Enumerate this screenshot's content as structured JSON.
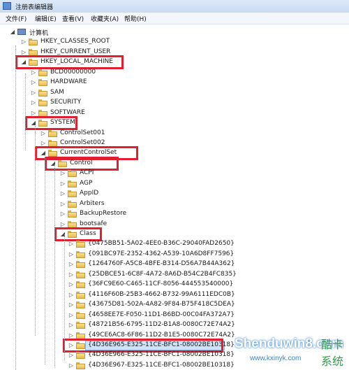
{
  "window": {
    "title": "注册表编辑器"
  },
  "menu": [
    "文件(F)",
    "编辑(E)",
    "查看(V)",
    "收藏夹(A)",
    "帮助(H)"
  ],
  "tree": [
    {
      "label": "计算机",
      "depth": 0,
      "expanded": true,
      "type": "computer"
    },
    {
      "label": "HKEY_CLASSES_ROOT",
      "depth": 1,
      "expanded": false
    },
    {
      "label": "HKEY_CURRENT_USER",
      "depth": 1,
      "expanded": false
    },
    {
      "label": "HKEY_LOCAL_MACHINE",
      "depth": 1,
      "expanded": true,
      "highlight": true
    },
    {
      "label": "BCD00000000",
      "depth": 2,
      "expanded": false
    },
    {
      "label": "HARDWARE",
      "depth": 2,
      "expanded": false
    },
    {
      "label": "SAM",
      "depth": 2,
      "expanded": false
    },
    {
      "label": "SECURITY",
      "depth": 2,
      "expanded": false
    },
    {
      "label": "SOFTWARE",
      "depth": 2,
      "expanded": false
    },
    {
      "label": "SYSTEM",
      "depth": 2,
      "expanded": true,
      "highlight": true
    },
    {
      "label": "ControlSet001",
      "depth": 3,
      "expanded": false
    },
    {
      "label": "ControlSet002",
      "depth": 3,
      "expanded": false
    },
    {
      "label": "CurrentControlSet",
      "depth": 3,
      "expanded": true,
      "highlight": true
    },
    {
      "label": "Control",
      "depth": 4,
      "expanded": true,
      "highlight": true
    },
    {
      "label": "ACPI",
      "depth": 5,
      "expanded": false
    },
    {
      "label": "AGP",
      "depth": 5,
      "expanded": false
    },
    {
      "label": "AppID",
      "depth": 5,
      "expanded": false
    },
    {
      "label": "Arbiters",
      "depth": 5,
      "expanded": false
    },
    {
      "label": "BackupRestore",
      "depth": 5,
      "expanded": false
    },
    {
      "label": "bootsafe",
      "depth": 5,
      "expanded": false
    },
    {
      "label": "Class",
      "depth": 5,
      "expanded": true,
      "highlight": true
    },
    {
      "label": "{0475BB51-5A02-4EE0-B36C-29040FAD2650}",
      "depth": 6,
      "expanded": false
    },
    {
      "label": "{091BC97E-2352-4362-A539-10A6D8FF7596}",
      "depth": 6,
      "expanded": false
    },
    {
      "label": "{1264760F-A5C8-4BFE-B314-D56A7B44A362}",
      "depth": 6,
      "expanded": false
    },
    {
      "label": "{25DBCE51-6C8F-4A72-8A6D-B54C2B4FC835}",
      "depth": 6,
      "expanded": false
    },
    {
      "label": "{36FC9E60-C465-11CF-8056-444553540000}",
      "depth": 6,
      "expanded": false
    },
    {
      "label": "{4116F60B-25B3-4662-B732-99A6111EDC0B}",
      "depth": 6,
      "expanded": false
    },
    {
      "label": "{43675D81-502A-4A82-9F84-B75F418C5DEA}",
      "depth": 6,
      "expanded": false
    },
    {
      "label": "{4658EE7E-F050-11D1-B6BD-00C04FA372A7}",
      "depth": 6,
      "expanded": false
    },
    {
      "label": "{48721B56-6795-11D2-B1A8-0080C72E74A2}",
      "depth": 6,
      "expanded": false
    },
    {
      "label": "{49CE6AC8-6F86-11D2-B1E5-0080C72E74A2}",
      "depth": 6,
      "expanded": false
    },
    {
      "label": "{4D36E965-E325-11CE-BFC1-08002BE10318}",
      "depth": 6,
      "expanded": false,
      "highlight": true,
      "selected": true
    },
    {
      "label": "{4D36E966-E325-11CE-BFC1-08002BE10318}",
      "depth": 6,
      "expanded": false
    },
    {
      "label": "{4D36E967-E325-11CE-BFC1-08002BE10318}",
      "depth": 6,
      "expanded": false
    }
  ],
  "watermark": {
    "main": "Shenduwin8.com",
    "sub": "www.kxinyk.com",
    "cn": "酷卡系统"
  },
  "colors": {
    "highlight": "#e02030",
    "selection": "#cfe3f8"
  }
}
